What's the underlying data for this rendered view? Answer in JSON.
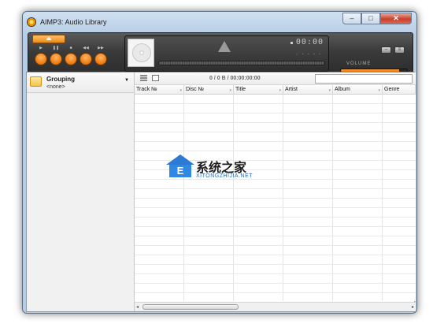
{
  "window": {
    "title": "AIMP3: Audio Library",
    "buttons": {
      "minimize": "–",
      "maximize": "□",
      "close": "✕"
    }
  },
  "player": {
    "eject_label": "⏏",
    "transport": [
      {
        "name": "play",
        "symbol": "▶"
      },
      {
        "name": "pause",
        "symbol": "❚❚"
      },
      {
        "name": "stop",
        "symbol": "■"
      },
      {
        "name": "prev",
        "symbol": "◀◀"
      },
      {
        "name": "next",
        "symbol": "▶▶"
      }
    ],
    "time": "00:00",
    "mini_icons": "♪ ▪ ▪ ▪ ▪",
    "volume_label": "VOLUME",
    "volume_level": 0.88,
    "small_buttons": [
      "–",
      "≡"
    ]
  },
  "library": {
    "grouping_title": "Grouping",
    "grouping_value": "<none>",
    "info": "0 / 0 B / 00:00:00:00",
    "search_placeholder": "",
    "columns": [
      "Track №",
      "Disc №",
      "Title",
      "Artist",
      "Album",
      "Genre"
    ]
  },
  "watermark": {
    "logo_char": "E",
    "chinese": "系统之家",
    "english": "XITONGZHIJIA.NET"
  },
  "colors": {
    "accent": "#f08a12",
    "watermark_blue": "#2f88e3"
  }
}
